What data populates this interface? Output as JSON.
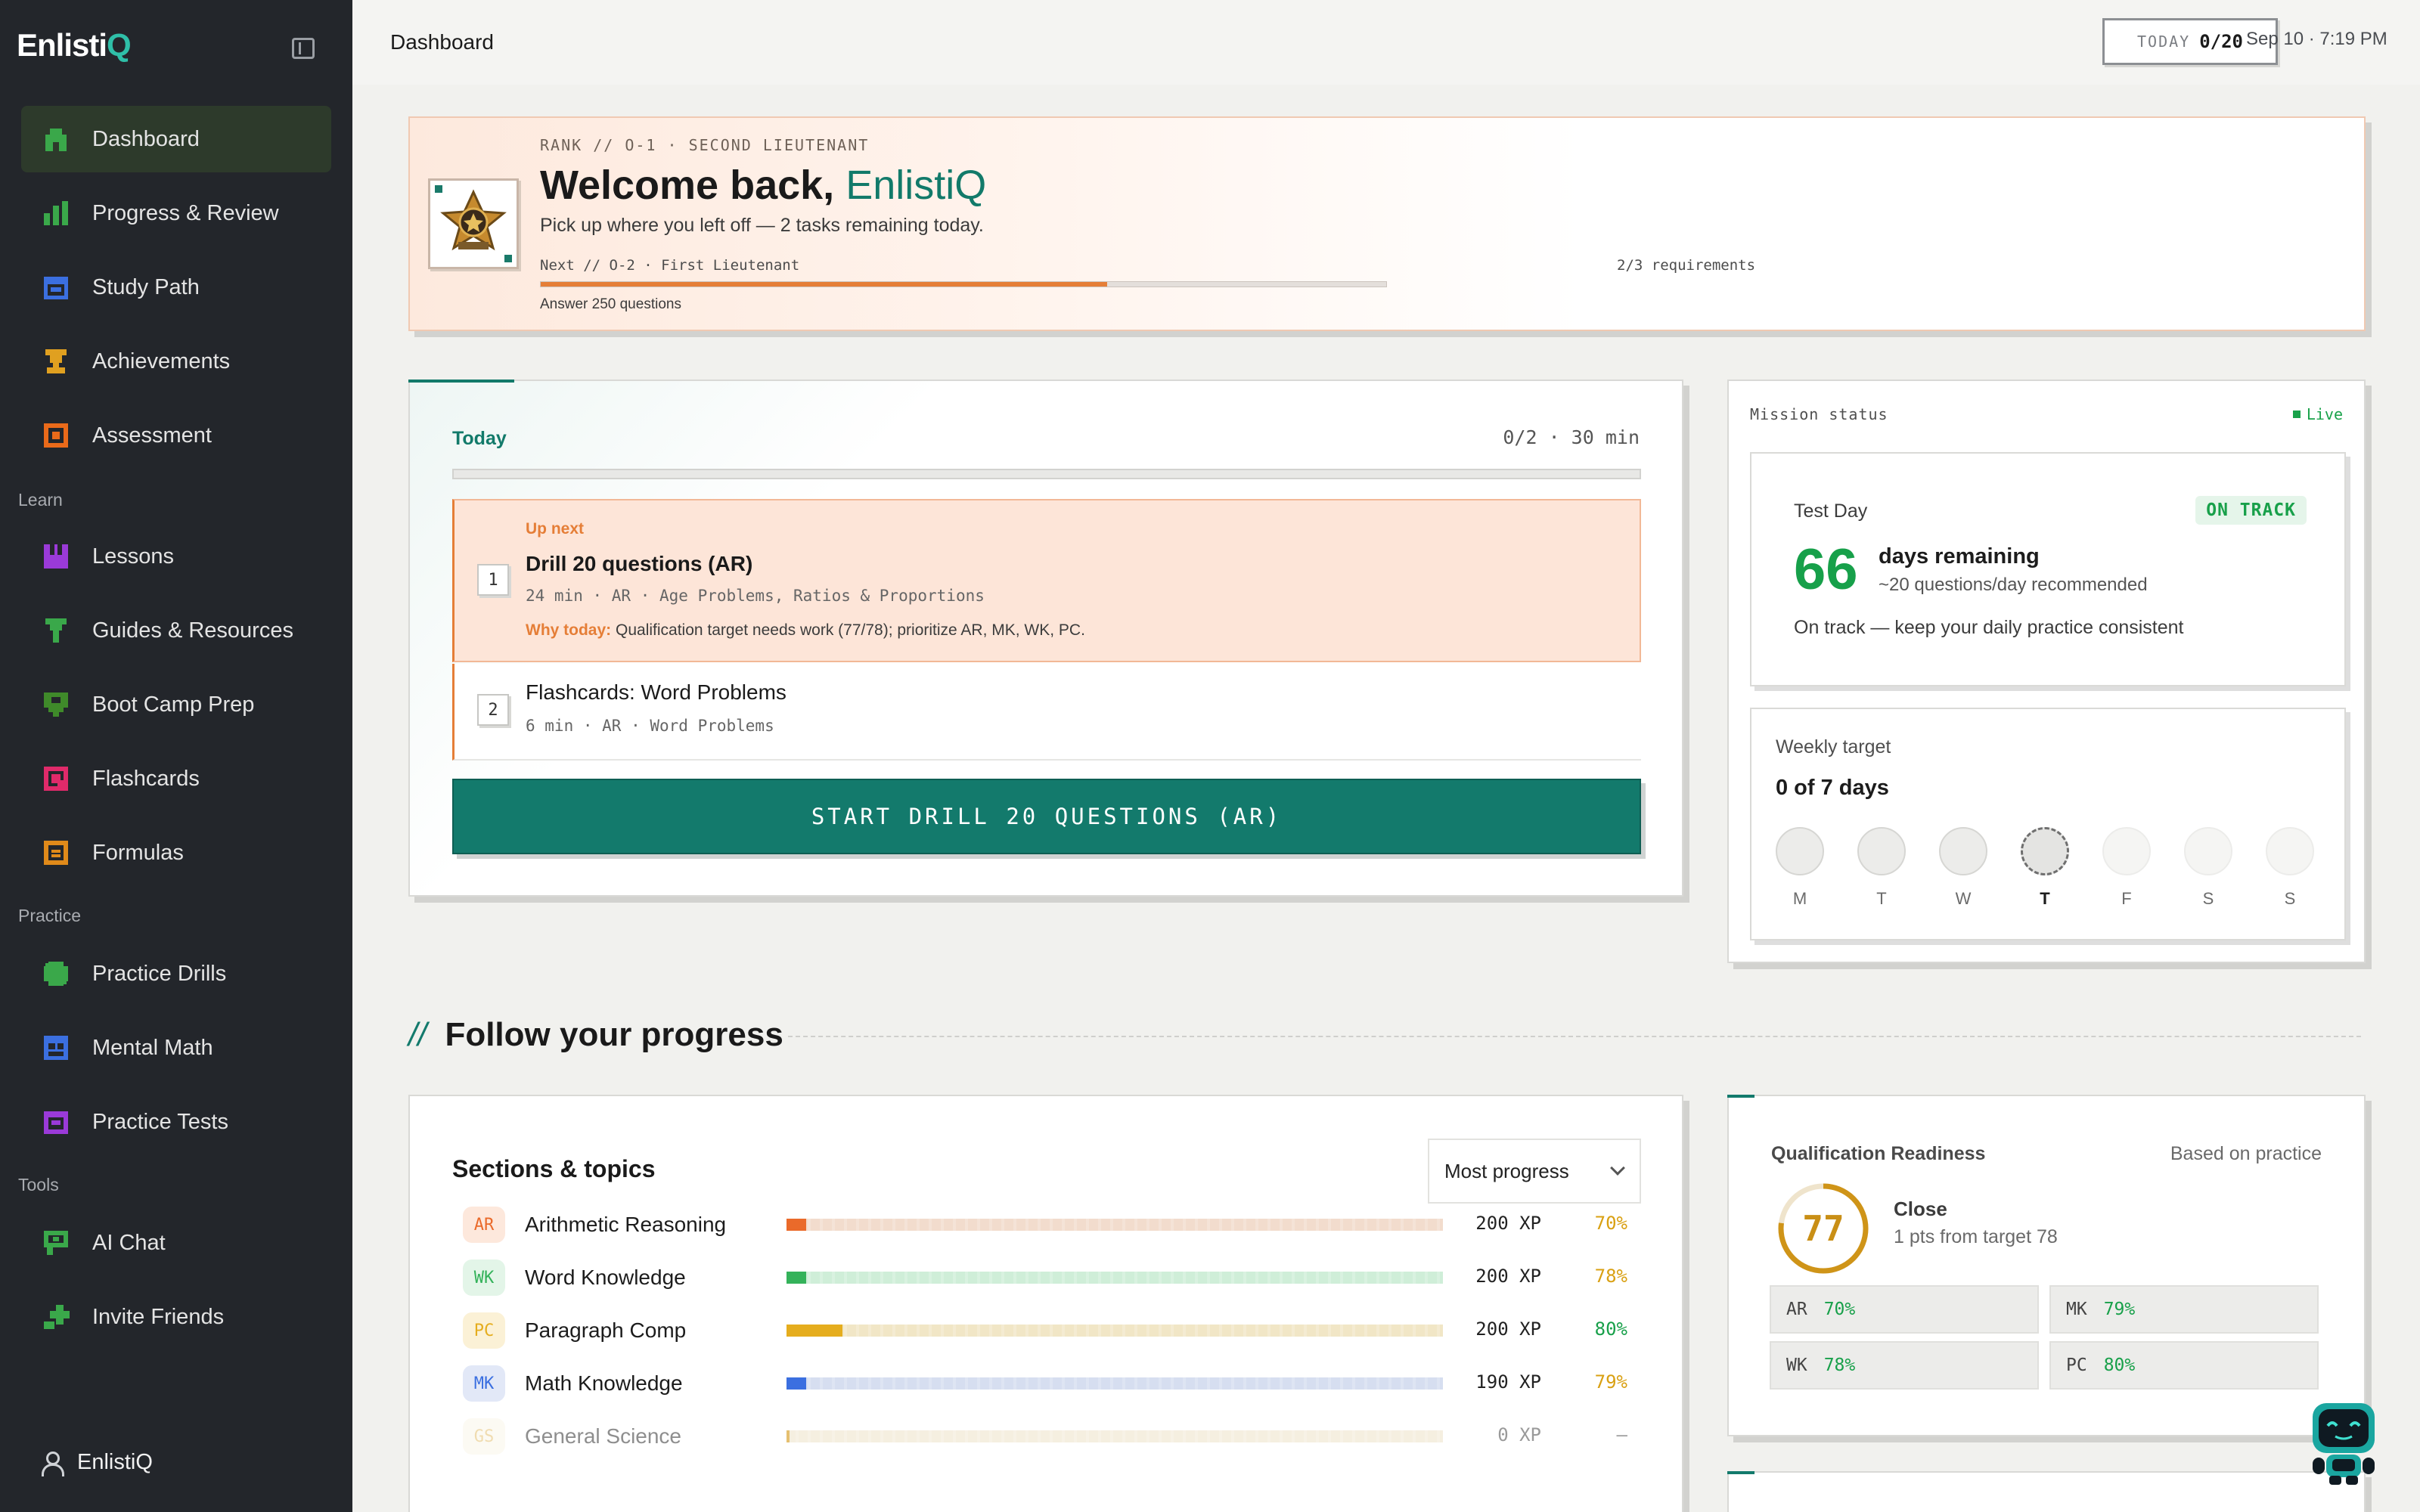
{
  "app": {
    "logo_main": "Enlisti",
    "logo_q": "Q"
  },
  "sidebar": {
    "items": [
      {
        "label": "Dashboard",
        "icon": "dashboard-icon",
        "color": "#3aa84a",
        "active": true
      },
      {
        "label": "Progress & Review",
        "icon": "chart-bars-icon",
        "color": "#3aa84a"
      },
      {
        "label": "Study Path",
        "icon": "calendar-icon",
        "color": "#3b6fe0"
      },
      {
        "label": "Achievements",
        "icon": "trophy-icon",
        "color": "#e0a020"
      },
      {
        "label": "Assessment",
        "icon": "target-icon",
        "color": "#ea6a1a"
      }
    ],
    "section_learn": "Learn",
    "learn_items": [
      {
        "label": "Lessons",
        "icon": "book-icon",
        "color": "#9a3ad8"
      },
      {
        "label": "Guides & Resources",
        "icon": "lightbulb-icon",
        "color": "#3aa84a"
      },
      {
        "label": "Boot Camp Prep",
        "icon": "shield-icon",
        "color": "#3f8a2a"
      },
      {
        "label": "Flashcards",
        "icon": "flashcard-icon",
        "color": "#e02a6a"
      },
      {
        "label": "Formulas",
        "icon": "formula-icon",
        "color": "#e08a1a"
      }
    ],
    "section_practice": "Practice",
    "practice_items": [
      {
        "label": "Practice Drills",
        "icon": "gear-drill-icon",
        "color": "#3aa84a"
      },
      {
        "label": "Mental Math",
        "icon": "grid-icon",
        "color": "#3b6fe0"
      },
      {
        "label": "Practice Tests",
        "icon": "clipboard-icon",
        "color": "#9a3ad8"
      }
    ],
    "section_tools": "Tools",
    "tools_items": [
      {
        "label": "AI Chat",
        "icon": "chat-icon",
        "color": "#3aa84a"
      },
      {
        "label": "Invite Friends",
        "icon": "invite-icon",
        "color": "#3aa84a"
      }
    ],
    "user_name": "EnlistiQ"
  },
  "topbar": {
    "title": "Dashboard",
    "today_label": "TODAY",
    "today_value": "0/20",
    "date_time": "Sep 10 · 7:19 PM"
  },
  "welcome": {
    "rank_line": "RANK // O-1 · SECOND LIEUTENANT",
    "title_prefix": "Welcome back, ",
    "title_name": "EnlistiQ",
    "subtitle": "Pick up where you left off — 2 tasks remaining today.",
    "next_rank": "Next // O-2 · First Lieutenant",
    "req_count": "2/3 requirements",
    "requirement": "Answer 250 questions",
    "progress_fraction": 0.67
  },
  "today": {
    "label": "Today",
    "meta": "0/2 · 30 min",
    "progress_fraction": 0,
    "tasks": [
      {
        "num": "1",
        "upnext": "Up next",
        "title": "Drill 20 questions (AR)",
        "meta": "24 min · AR · Age Problems, Ratios & Proportions",
        "why_label": "Why today:",
        "why_text": " Qualification target needs work (77/78); prioritize AR, MK, WK, PC."
      },
      {
        "num": "2",
        "title": "Flashcards: Word Problems",
        "meta": "6 min · AR · Word Problems"
      }
    ],
    "start_button": "START DRILL 20 QUESTIONS (AR)"
  },
  "mission": {
    "label": "Mission status",
    "live": "Live",
    "test_day_label": "Test Day",
    "status_badge": "ON TRACK",
    "days": "66",
    "days_text": "days remaining",
    "days_sub": "~20 questions/day recommended",
    "message": "On track — keep your daily practice consistent",
    "weekly_label": "Weekly target",
    "weekly_value": "0 of 7 days",
    "days_of_week": [
      "M",
      "T",
      "W",
      "T",
      "F",
      "S",
      "S"
    ]
  },
  "progress_section": {
    "slashes": "//",
    "title": "Follow your progress"
  },
  "sections": {
    "title": "Sections & topics",
    "sort_value": "Most progress",
    "topics": [
      {
        "abbr": "AR",
        "name": "Arithmetic Reasoning",
        "xp": "200 XP",
        "pct": "70%",
        "fill": 0.03,
        "color": "#ea6a2a",
        "track": "#f2dccd",
        "abbr_bg": "#fde8dc",
        "pct_color": "#d9a012"
      },
      {
        "abbr": "WK",
        "name": "Word Knowledge",
        "xp": "200 XP",
        "pct": "78%",
        "fill": 0.03,
        "color": "#34b25a",
        "track": "#cfeed8",
        "abbr_bg": "#e3f5e8",
        "pct_color": "#d9a012"
      },
      {
        "abbr": "PC",
        "name": "Paragraph Comp",
        "xp": "200 XP",
        "pct": "80%",
        "fill": 0.085,
        "color": "#e5ad1e",
        "track": "#f1e6c6",
        "abbr_bg": "#fbf1d6",
        "pct_color": "#18a04a"
      },
      {
        "abbr": "MK",
        "name": "Math Knowledge",
        "xp": "190 XP",
        "pct": "79%",
        "fill": 0.03,
        "color": "#3b6fe0",
        "track": "#d6def0",
        "abbr_bg": "#e2e8f7",
        "pct_color": "#d9a012"
      },
      {
        "abbr": "GS",
        "name": "General Science",
        "xp": "0 XP",
        "pct": "—",
        "fill": 0.005,
        "color": "#e5c070",
        "track": "#f5efe0",
        "abbr_bg": "#fbf6ea",
        "pct_color": "#9a9a9a"
      }
    ]
  },
  "qualification": {
    "title": "Qualification Readiness",
    "basis": "Based on practice",
    "score": "77",
    "score_fraction": 0.77,
    "status": "Close",
    "gap": "1 pts from target 78",
    "cells": [
      {
        "k": "AR",
        "v": "70%"
      },
      {
        "k": "MK",
        "v": "79%"
      },
      {
        "k": "WK",
        "v": "78%"
      },
      {
        "k": "PC",
        "v": "80%"
      }
    ]
  }
}
